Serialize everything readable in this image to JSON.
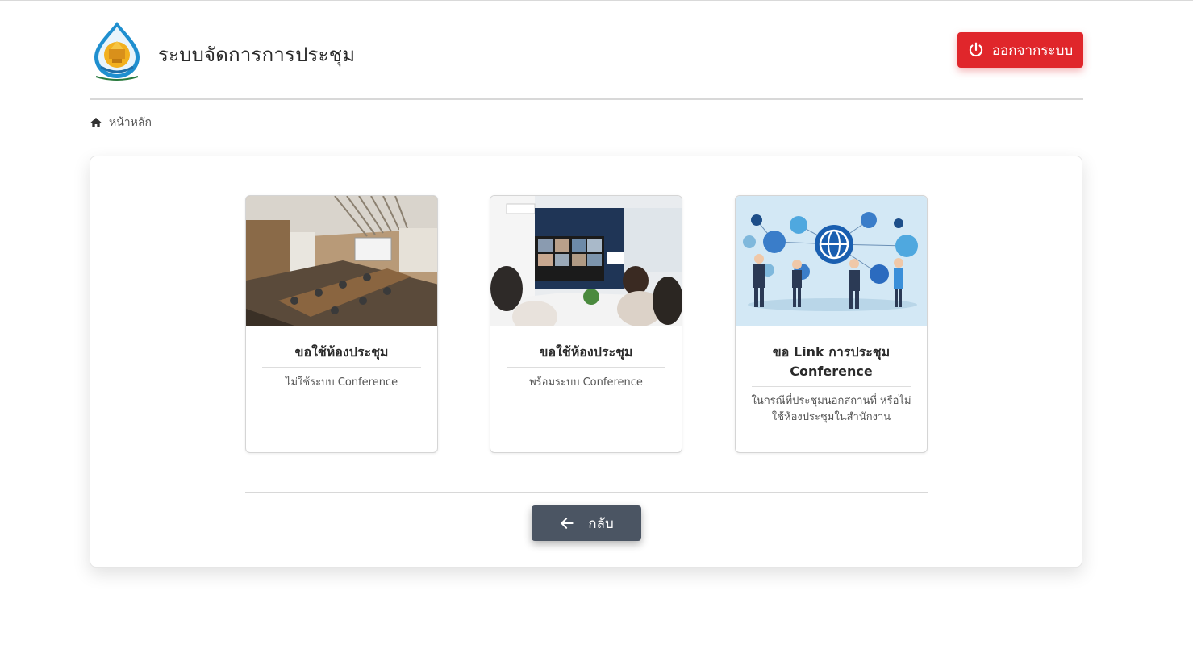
{
  "header": {
    "app_title": "ระบบจัดการการประชุม",
    "logout_label": "ออกจากระบบ",
    "logo_icon": "department-seal-logo"
  },
  "breadcrumb": {
    "home_label": "หน้าหลัก",
    "home_icon": "home-icon"
  },
  "cards": [
    {
      "title": "ขอใช้ห้องประชุม",
      "subtitle": "ไม่ใช้ระบบ Conference",
      "image": "conference-room-photo"
    },
    {
      "title": "ขอใช้ห้องประชุม",
      "subtitle": "พร้อมระบบ Conference",
      "image": "video-meeting-photo"
    },
    {
      "title_line1": "ขอ Link การประชุม",
      "title_line2": "Conference",
      "subtitle_line1": "ในกรณีที่ประชุมนอกสถานที่ หรือไม่",
      "subtitle_line2": "ใช้ห้องประชุมในสำนักงาน",
      "image": "network-people-illustration"
    }
  ],
  "back_label": "กลับ",
  "colors": {
    "logout": "#e0262b",
    "back": "#4b5563",
    "accent_blue": "#1a6fc4"
  }
}
